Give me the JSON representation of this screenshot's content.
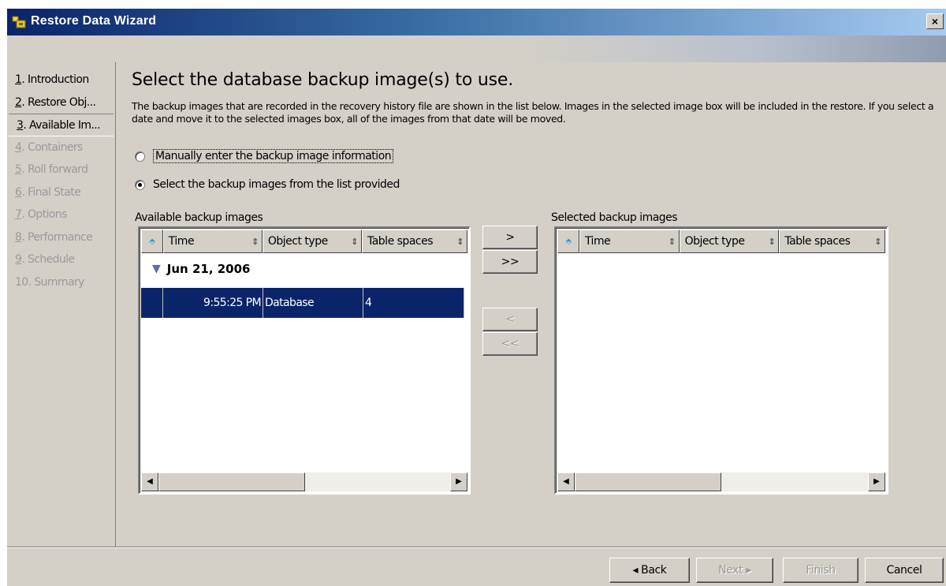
{
  "window": {
    "title": "Restore Data Wizard",
    "close_glyph": "×"
  },
  "nav": {
    "items": [
      {
        "num": "1",
        "label": ". Introduction",
        "state": "enabled"
      },
      {
        "num": "2",
        "label": ". Restore Obj...",
        "state": "enabled"
      },
      {
        "num": "3",
        "label": ". Available Im...",
        "state": "active"
      },
      {
        "num": "4",
        "label": ". Containers",
        "state": "disabled"
      },
      {
        "num": "5",
        "label": ". Roll forward",
        "state": "disabled"
      },
      {
        "num": "6",
        "label": ". Final State",
        "state": "disabled"
      },
      {
        "num": "7",
        "label": ". Options",
        "state": "disabled"
      },
      {
        "num": "8",
        "label": ". Performance",
        "state": "disabled"
      },
      {
        "num": "9",
        "label": ". Schedule",
        "state": "disabled"
      },
      {
        "num": "10",
        "label": ". Summary",
        "state": "disabled"
      }
    ]
  },
  "main": {
    "heading": "Select the database backup image(s) to use.",
    "description": "The backup images that are recorded in the recovery history file are shown in the list below. Images in the selected image box will be included in the restore. If you select a date and move it to the selected images box, all of the images from that date will be moved.",
    "radio_manual": {
      "label": "Manually enter the backup image information",
      "checked": false
    },
    "radio_list": {
      "label": "Select the backup images from the list provided",
      "checked": true
    }
  },
  "available": {
    "label": "Available backup images",
    "columns": [
      "Time",
      "Object type",
      "Table spaces"
    ],
    "group": "Jun 21, 2006",
    "rows": [
      {
        "time": "9:55:25 PM",
        "object_type": "Database",
        "table_spaces": "4"
      }
    ]
  },
  "selected": {
    "label": "Selected backup images",
    "columns": [
      "Time",
      "Object type",
      "Table spaces"
    ]
  },
  "move_buttons": {
    "add": ">",
    "add_all": ">>",
    "remove": "<",
    "remove_all": "<<"
  },
  "footer": {
    "back": "◂ Back",
    "next": "Next ▸",
    "finish": "Finish",
    "cancel": "Cancel"
  },
  "colors": {
    "title_bar": "#0a246a",
    "selection": "#0a246a",
    "face": "#d4d0c8"
  }
}
